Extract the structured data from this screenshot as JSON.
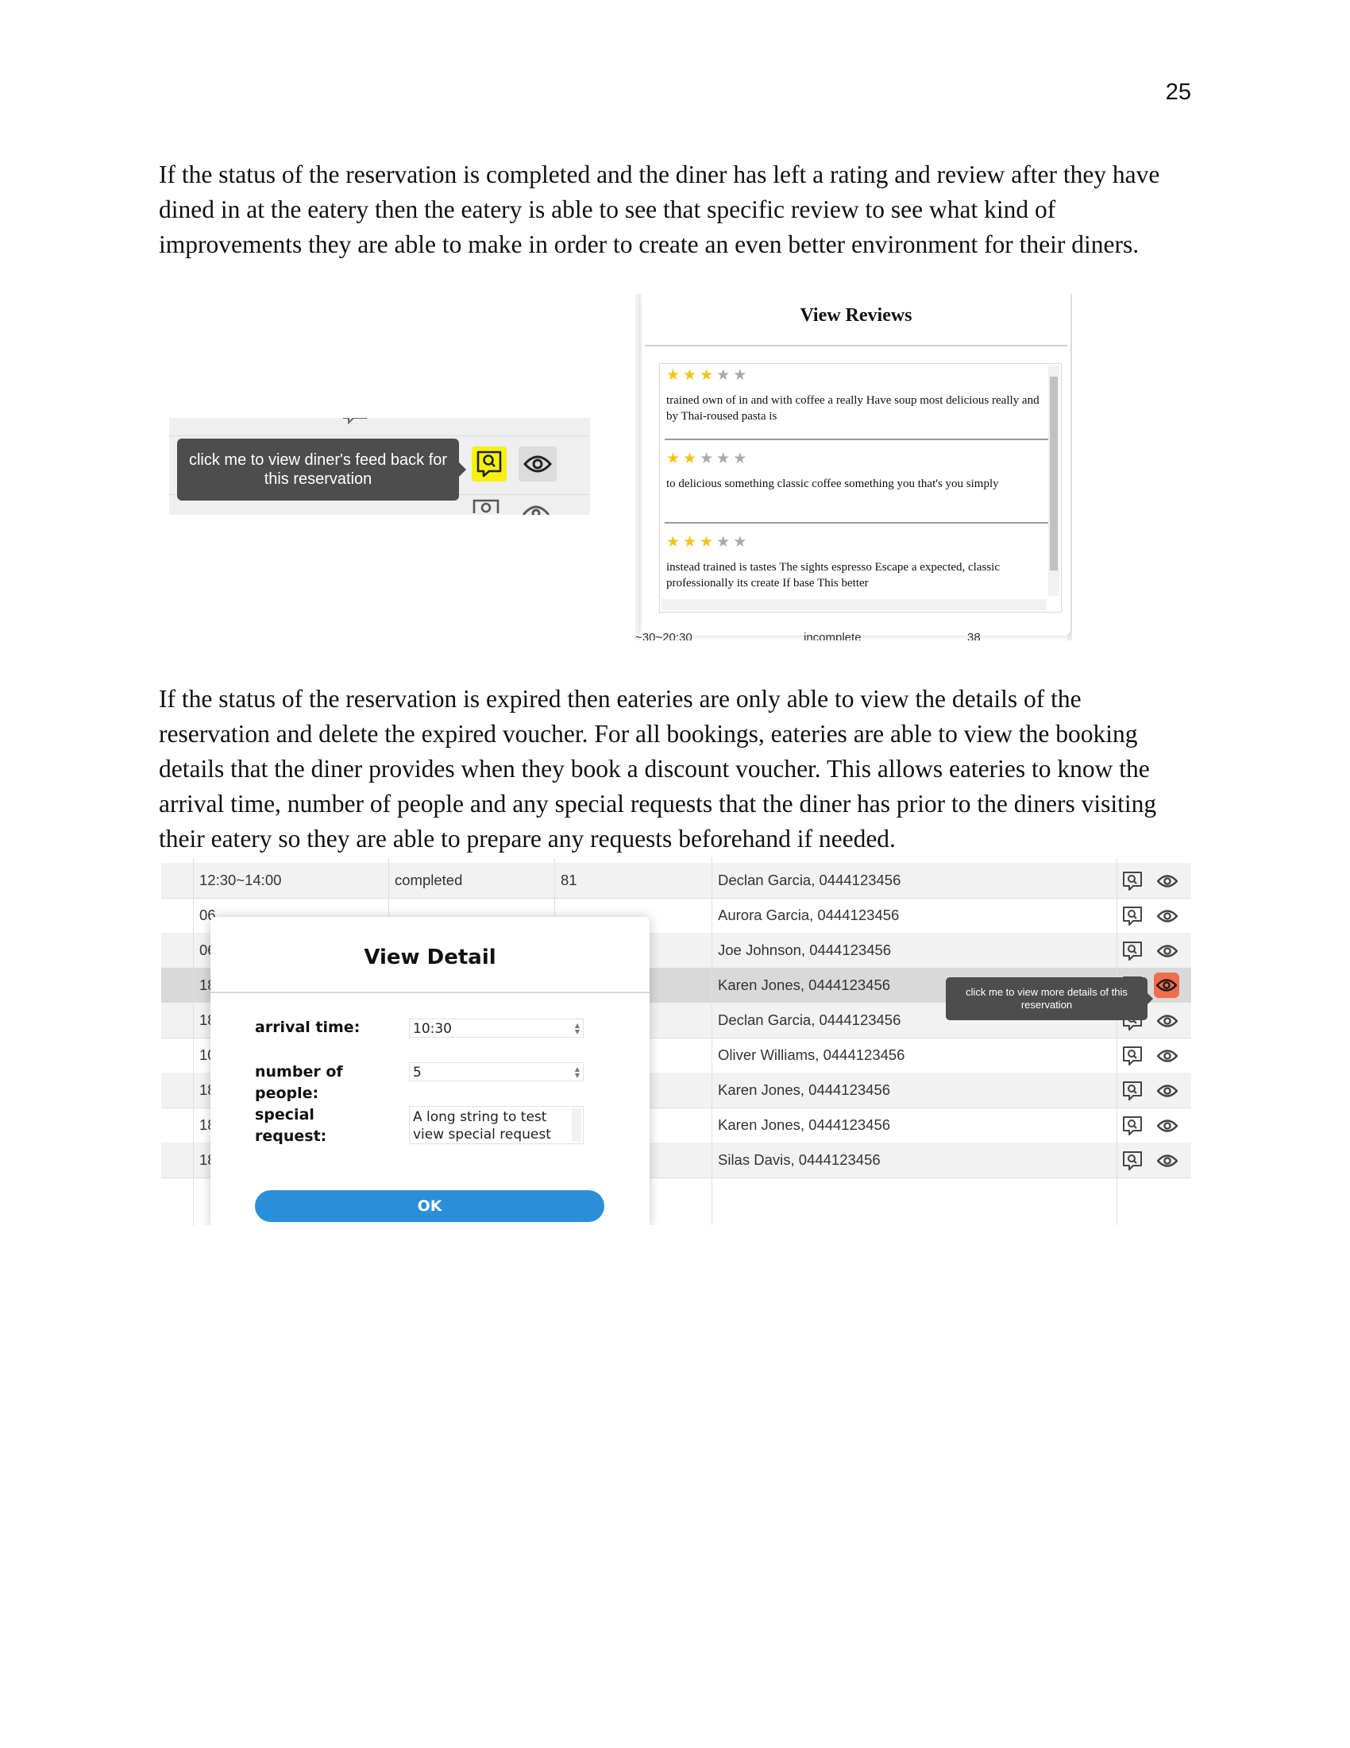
{
  "page_number": "25",
  "paragraph_1": "If the status of the reservation is completed and the diner has left a rating and review after they have dined in at the eatery then the eatery is able to see that specific review to see what kind of improvements they are able to make in order to create an even better environment for their diners.",
  "paragraph_2": "If the status of the reservation is expired then eateries are only able to view the details of the reservation and delete the expired voucher. For all bookings, eateries are able to view the booking details that the diner provides when they book a discount voucher. This allows eateries to know the arrival time, number of people and any special requests that the diner has prior to the diners visiting their eatery so they are able to prepare any requests beforehand if needed.",
  "feedback_tooltip": "click me to view diner's feed back for this reservation",
  "view_reviews": {
    "title": "View Reviews",
    "reviews": [
      {
        "rating": 3,
        "text": "trained own of in and with coffee a really Have soup most delicious really and by Thai-roused pasta is"
      },
      {
        "rating": 2,
        "text": "to delicious something classic coffee something you that's you simply"
      },
      {
        "rating": 3,
        "text": "instead trained is tastes The sights espresso Escape a expected, classic professionally its create If base This better"
      }
    ],
    "peek_row": {
      "time": "~30~20:30",
      "status": "incomplete",
      "count": "38"
    }
  },
  "table": {
    "rows": [
      {
        "time": "12:30~14:00",
        "status": "completed",
        "count": "81",
        "diner": "Declan Garcia, 0444123456"
      },
      {
        "time": "06",
        "status": "",
        "count": "",
        "diner": "Aurora Garcia, 0444123456"
      },
      {
        "time": "06",
        "status": "",
        "count": "",
        "diner": "Joe Johnson, 0444123456"
      },
      {
        "time": "18",
        "status": "",
        "count": "",
        "diner": "Karen Jones, 0444123456"
      },
      {
        "time": "18",
        "status": "",
        "count": "",
        "diner": "Declan Garcia, 0444123456"
      },
      {
        "time": "10",
        "status": "",
        "count": "",
        "diner": "Oliver Williams, 0444123456"
      },
      {
        "time": "18",
        "status": "",
        "count": "",
        "diner": "Karen Jones, 0444123456"
      },
      {
        "time": "18",
        "status": "",
        "count": "",
        "diner": "Karen Jones, 0444123456"
      },
      {
        "time": "18",
        "status": "",
        "count": "",
        "diner": "Silas Davis, 0444123456"
      }
    ],
    "highlighted_row": 3,
    "details_tooltip": "click me to view more details of this reservation"
  },
  "view_detail": {
    "title": "View Detail",
    "arrival_label": "arrival time:",
    "arrival_value": "10:30",
    "people_label": "number of people:",
    "people_value": "5",
    "request_label": "special request:",
    "request_value": "A long string to test view special request",
    "ok_label": "OK"
  },
  "colors": {
    "feedback_highlight": "#f6f20a",
    "details_active": "#f26d4d",
    "ok_button": "#2a8fd8",
    "star_on": "#f0c419",
    "star_off": "#a9a9a9"
  },
  "icons": {
    "feedback": "feedback-search-icon",
    "details": "eye-icon"
  }
}
